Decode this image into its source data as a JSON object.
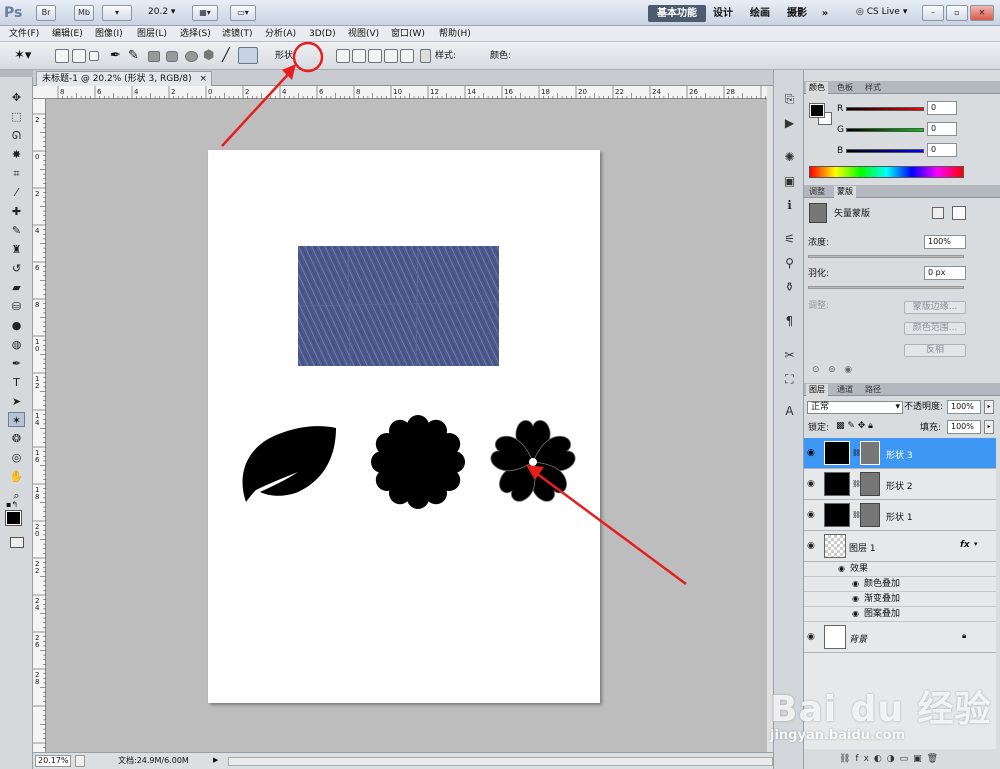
{
  "app": {
    "logo": "Ps"
  },
  "titlebar": {
    "br_label": "Br",
    "mb_label": "Mb",
    "zoom_value": "20.2",
    "workspaces": [
      "基本功能",
      "设计",
      "绘画",
      "摄影"
    ],
    "more_label": "»",
    "cslive_label": "CS Live"
  },
  "menu": [
    "文件(F)",
    "编辑(E)",
    "图像(I)",
    "图层(L)",
    "选择(S)",
    "滤镜(T)",
    "分析(A)",
    "3D(D)",
    "视图(V)",
    "窗口(W)",
    "帮助(H)"
  ],
  "options": {
    "shape_label": "形状:",
    "style_label": "样式:",
    "color_label": "颜色:",
    "color_value": "#000000"
  },
  "document": {
    "tab_title": "未标题-1 @ 20.2% (形状 3, RGB/8)",
    "close_label": "×",
    "hruler_ticks": [
      "8",
      "6",
      "4",
      "2",
      "0",
      "2",
      "4",
      "6",
      "8",
      "10",
      "12",
      "14",
      "16",
      "18",
      "20",
      "22",
      "24",
      "26",
      "28"
    ],
    "vruler_ticks": [
      "2",
      "0",
      "2",
      "4",
      "6",
      "8",
      "1\n0",
      "1\n2",
      "1\n4",
      "1\n6",
      "1\n8",
      "2\n0",
      "2\n2",
      "2\n4",
      "2\n6",
      "2\n8"
    ]
  },
  "status": {
    "zoom": "20.17%",
    "doc_info": "文档:24.9M/6.00M"
  },
  "color_panel": {
    "tabs": [
      "颜色",
      "色板",
      "样式"
    ],
    "channels": [
      {
        "label": "R",
        "value": "0"
      },
      {
        "label": "G",
        "value": "0"
      },
      {
        "label": "B",
        "value": "0"
      }
    ]
  },
  "masks_panel": {
    "tabs": [
      "调整",
      "蒙版"
    ],
    "mask_type": "矢量蒙版",
    "density_label": "浓度:",
    "density_value": "100%",
    "feather_label": "羽化:",
    "feather_value": "0 px",
    "refine_label": "调整:",
    "buttons": [
      "蒙版边缘...",
      "颜色范围...",
      "反相"
    ]
  },
  "layers_panel": {
    "tabs": [
      "图层",
      "通道",
      "路径"
    ],
    "blend_mode": "正常",
    "opacity_label": "不透明度:",
    "opacity_value": "100%",
    "lock_label": "锁定:",
    "fill_label": "填充:",
    "fill_value": "100%",
    "layers": [
      {
        "name": "形状 3",
        "selected": true
      },
      {
        "name": "形状 2",
        "selected": false
      },
      {
        "name": "形状 1",
        "selected": false
      },
      {
        "name": "图层 1",
        "selected": false,
        "fx": "fx"
      }
    ],
    "effects_label": "效果",
    "effects": [
      "颜色叠加",
      "渐变叠加",
      "图案叠加"
    ],
    "background_name": "背景"
  },
  "watermark": {
    "brand": "Bai du 经验",
    "url": "jingyan.baidu.com"
  },
  "colors": {
    "selection_blue": "#3d97f5",
    "annotation_red": "#e61e1e",
    "pattern_blue": "#4a5688"
  }
}
